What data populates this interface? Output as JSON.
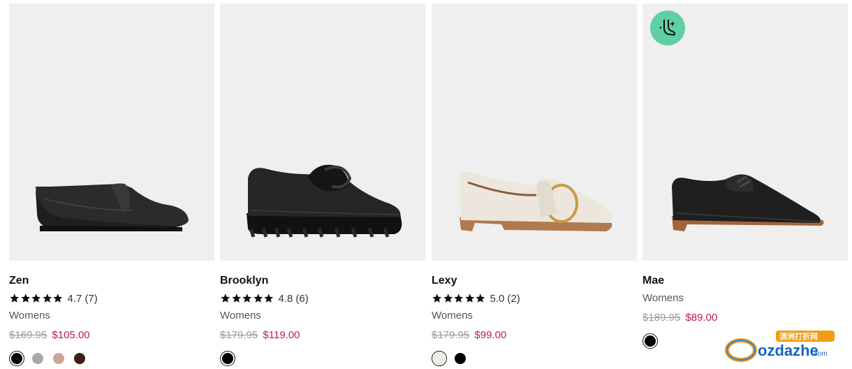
{
  "products": [
    {
      "name": "Zen",
      "rating": "4.7",
      "reviews": "(7)",
      "category": "Womens",
      "was_price": "$169.95",
      "now_price": "$105.00",
      "swatches": [
        "#000000",
        "#a8a8a8",
        "#c8a894",
        "#3b1e1a"
      ]
    },
    {
      "name": "Brooklyn",
      "rating": "4.8",
      "reviews": "(6)",
      "category": "Womens",
      "was_price": "$179.95",
      "now_price": "$119.00",
      "swatches": [
        "#000000"
      ]
    },
    {
      "name": "Lexy",
      "rating": "5.0",
      "reviews": "(2)",
      "category": "Womens",
      "was_price": "$179.95",
      "now_price": "$99.00",
      "swatches": [
        "#f2ece4",
        "#000000"
      ]
    },
    {
      "name": "Mae",
      "category": "Womens",
      "was_price": "$189.95",
      "now_price": "$89.00",
      "swatches": [
        "#000000"
      ],
      "badge_icon": "foot-care-icon"
    }
  ],
  "colors": {
    "sale_price": "#c2185b",
    "badge": "#5fd0a5",
    "image_bg": "#efefef"
  },
  "watermark": {
    "brand": "ozdazhe",
    "domain": ".com",
    "cn_text": "澳洲打折网"
  }
}
